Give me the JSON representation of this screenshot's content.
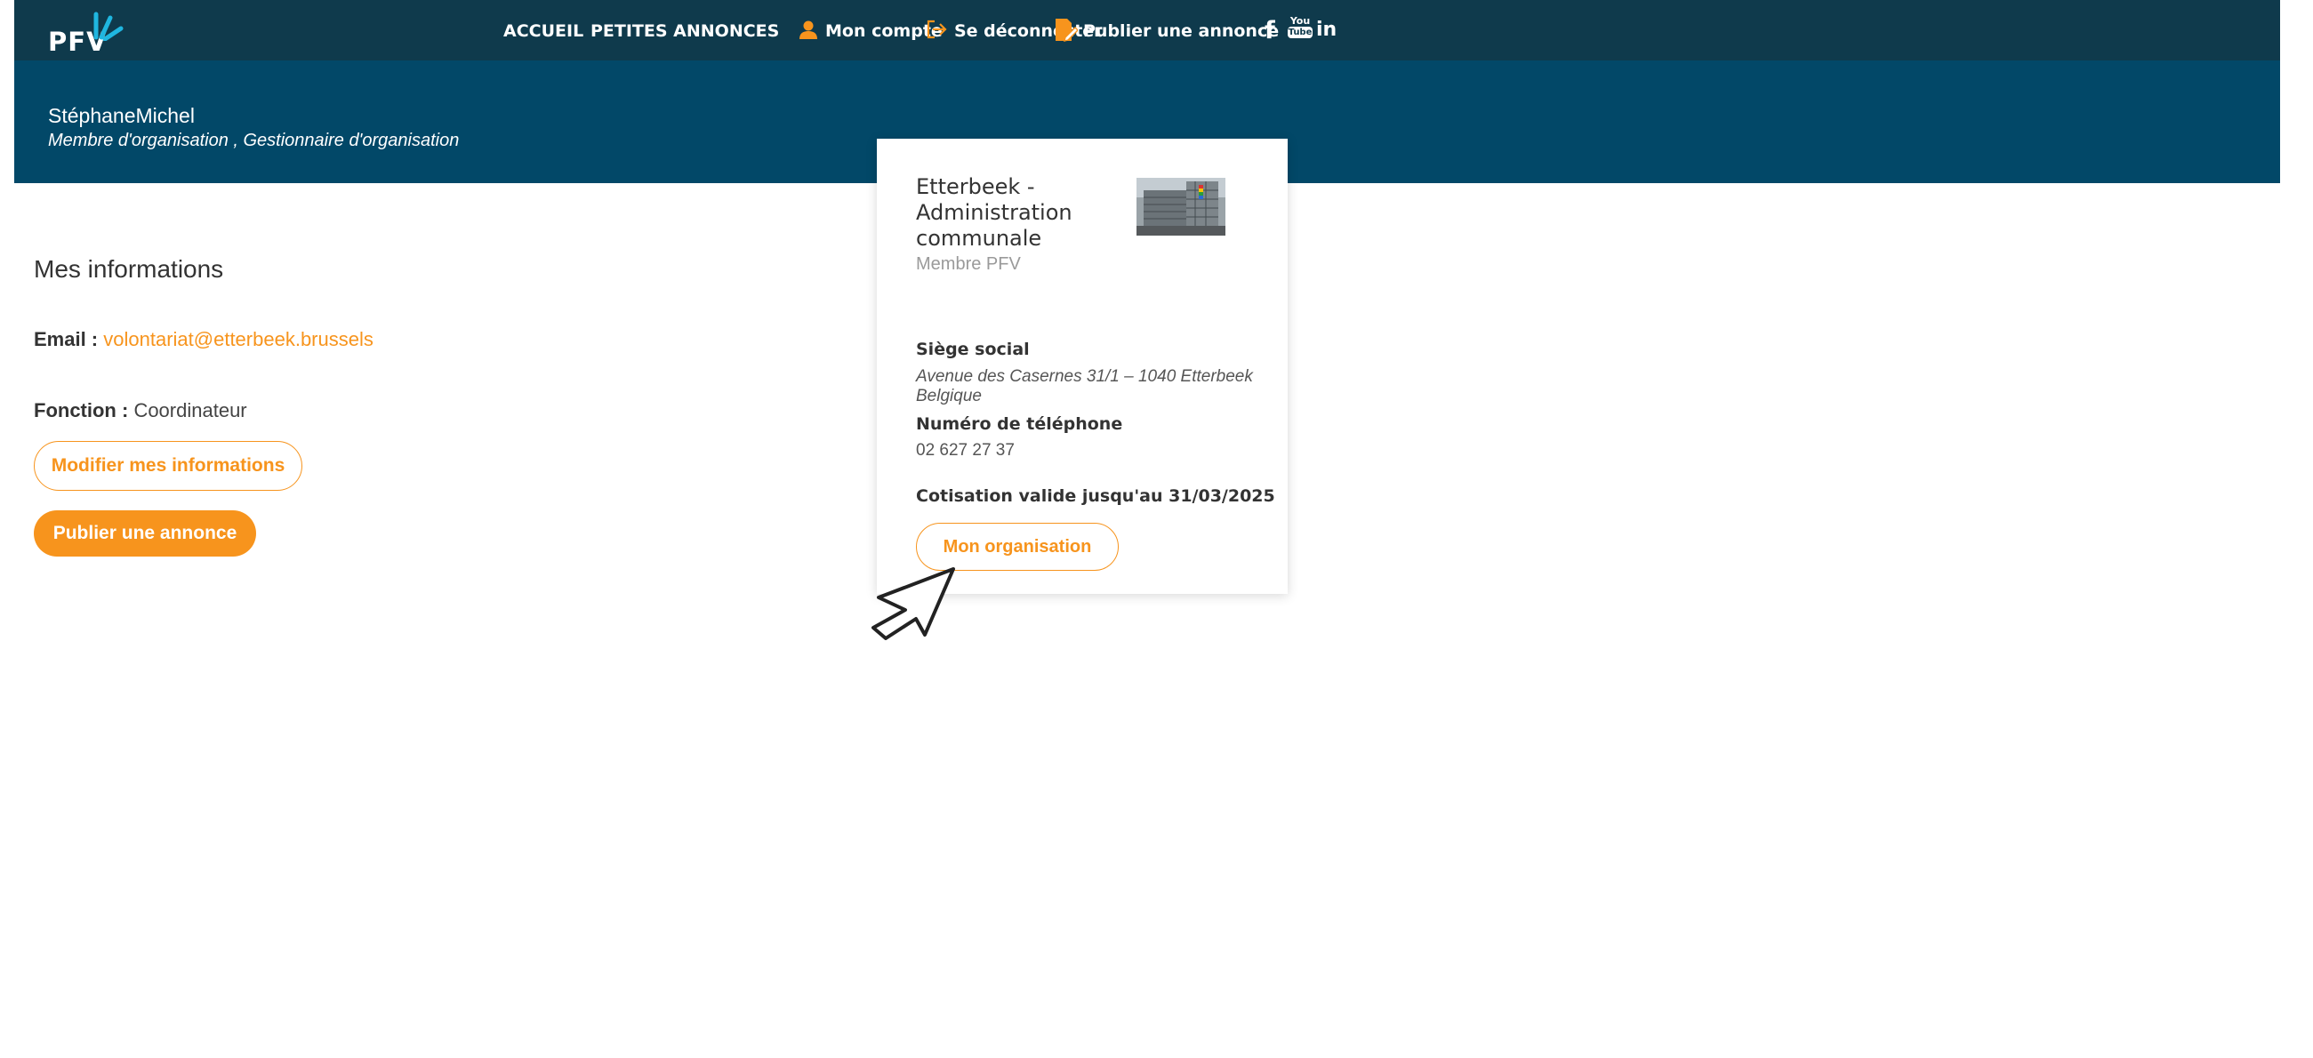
{
  "nav": {
    "logo_text": "PFV",
    "links": {
      "home": "ACCUEIL",
      "ads": "PETITES ANNONCES",
      "account": "Mon compte",
      "logout": "Se déconnecter",
      "publish": "Publier une annonce"
    },
    "social": {
      "facebook": "f",
      "youtube_top": "You",
      "youtube_bottom": "Tube",
      "linkedin": "in"
    }
  },
  "user": {
    "name": "StéphaneMichel",
    "roles": "Membre d'organisation , Gestionnaire d'organisation"
  },
  "info": {
    "title": "Mes informations",
    "email_label": "Email :",
    "email_value": "volontariat@etterbeek.brussels",
    "function_label": "Fonction :",
    "function_value": "Coordinateur",
    "edit_button": "Modifier mes informations",
    "publish_button": "Publier une annonce"
  },
  "organization": {
    "name": "Etterbeek - Administration communale",
    "membership": "Membre PFV",
    "hq_label": "Siège social",
    "hq_value": "Avenue des Casernes 31/1  – 1040 Etterbeek Belgique",
    "phone_label": "Numéro de téléphone",
    "phone_value": "02 627 27 37",
    "subscription": "Cotisation valide jusqu'au 31/03/2025",
    "button": "Mon organisation"
  },
  "colors": {
    "nav_bg": "#0f3a4c",
    "band_bg": "#024868",
    "accent": "#f7941d",
    "logo_icon": "#1fb6e0"
  },
  "icons": {
    "account": "user-icon",
    "logout": "logout-icon",
    "publish": "edit-document-icon",
    "facebook": "facebook-icon",
    "youtube": "youtube-icon",
    "linkedin": "linkedin-icon",
    "cursor": "mouse-pointer-icon"
  }
}
